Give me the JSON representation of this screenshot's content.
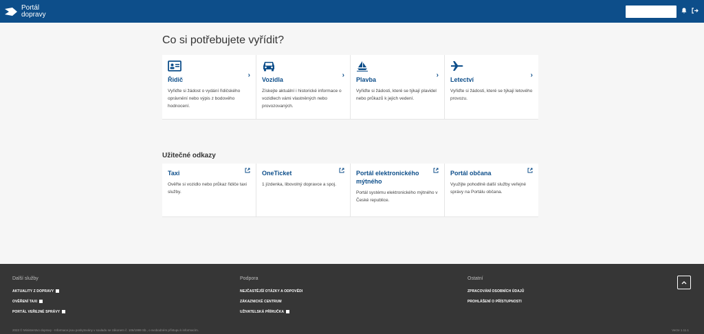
{
  "header": {
    "brand_line1": "Portál",
    "brand_line2": "dopravy"
  },
  "main": {
    "title": "Co si potřebujete vyřídit?",
    "agenda": [
      {
        "title": "Řidič",
        "desc": "Vyřiďte si žádost o vydání řidičského oprávnění nebo výpis z bodového hodnocení.",
        "icon": "id-card-icon"
      },
      {
        "title": "Vozidla",
        "desc": "Získejte aktuální i historické informace o vozidlech vámi vlastněných nebo provozovaných.",
        "icon": "car-icon"
      },
      {
        "title": "Plavba",
        "desc": "Vyřiďte si žádosti, které se týkají plavidel nebo průkazů k jejich vedení.",
        "icon": "sailboat-icon"
      },
      {
        "title": "Letectví",
        "desc": "Vyřiďte si žádosti, které se týkají letového provozu.",
        "icon": "airplane-icon"
      }
    ],
    "links_title": "Užitečné odkazy",
    "links": [
      {
        "title": "Taxi",
        "desc": "Ověřte si vozidlo nebo průkaz řidiče taxi služby."
      },
      {
        "title": "OneTicket",
        "desc": "1 jízdenka, libovolný dopravce a spoj."
      },
      {
        "title": "Portál elektronického mýtného",
        "desc": "Portál systému elektronického mýtného v České republice."
      },
      {
        "title": "Portál občana",
        "desc": "Využijte pohodlně další služby veřejné správy na Portálu občana."
      }
    ]
  },
  "footer": {
    "col1": {
      "title": "Další služby",
      "items": [
        "AKTUALITY Z DOPRAVY",
        "OVĚŘENÍ TAXI",
        "PORTÁL VEŘEJNÉ SPRÁVY"
      ]
    },
    "col2": {
      "title": "Podpora",
      "items": [
        "NEJČASTĚJŠÍ OTÁZKY A ODPOVĚDI",
        "ZÁKAZNICKÉ CENTRUM",
        "UŽIVATELSKÁ PŘÍRUČKA"
      ]
    },
    "col3": {
      "title": "Ostatní",
      "items": [
        "ZPRACOVÁNÍ OSOBNÍCH ÚDAJŮ",
        "PROHLÁŠENÍ O PŘÍSTUPNOSTI"
      ]
    },
    "copyright": "2023 © Ministerstvo dopravy - Informace jsou poskytovány v souladu se zákonem č. 106/1999 Sb., o svobodném přístupu k informacím.",
    "version": "Verze 1.11.1"
  },
  "colors": {
    "brand": "#0d4e8a",
    "footer": "#363636"
  }
}
